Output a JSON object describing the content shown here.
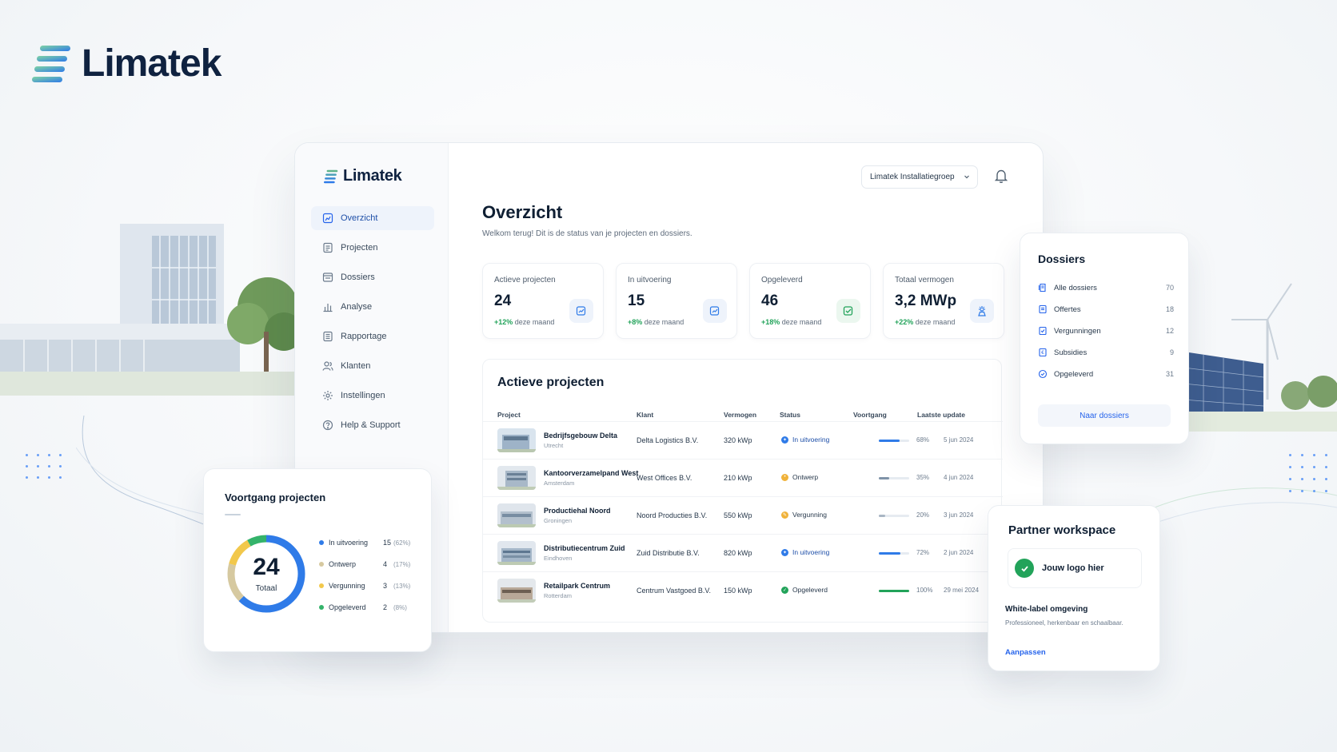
{
  "brand": {
    "name": "Limatek"
  },
  "sidebar": {
    "brand_name": "Limatek",
    "items": [
      {
        "label": "Overzicht",
        "icon": "dashboard-icon",
        "active": true
      },
      {
        "label": "Projecten",
        "icon": "document-icon"
      },
      {
        "label": "Dossiers",
        "icon": "folder-icon"
      },
      {
        "label": "Analyse",
        "icon": "bar-chart-icon"
      },
      {
        "label": "Rapportage",
        "icon": "report-icon"
      },
      {
        "label": "Klanten",
        "icon": "users-icon"
      },
      {
        "label": "Instellingen",
        "icon": "gear-icon"
      },
      {
        "label": "Help & Support",
        "icon": "help-icon"
      }
    ]
  },
  "header": {
    "org_select": "Limatek Installatiegroep"
  },
  "main": {
    "title": "Overzicht",
    "subtitle": "Welkom terug! Dit is de status van je projecten en dossiers.",
    "kpis": [
      {
        "label": "Actieve projecten",
        "value": "24",
        "delta": "+12%",
        "delta_suffix": "deze maand"
      },
      {
        "label": "In uitvoering",
        "value": "15",
        "delta": "+8%",
        "delta_suffix": "deze maand"
      },
      {
        "label": "Opgeleverd",
        "value": "46",
        "delta": "+18%",
        "delta_suffix": "deze maand"
      },
      {
        "label": "Totaal vermogen",
        "value": "3,2 MWp",
        "delta": "+22%",
        "delta_suffix": "deze maand"
      }
    ],
    "projects": {
      "title": "Actieve projecten",
      "columns": [
        "Project",
        "Klant",
        "Vermogen",
        "Status",
        "Voortgang",
        "Laatste update"
      ],
      "rows": [
        {
          "name": "Bedrijfsgebouw Delta",
          "city": "Utrecht",
          "client": "Delta Logistics B.V.",
          "power": "320 kWp",
          "status": "In uitvoering",
          "progress_text": "68%",
          "progress": 0.68,
          "updated": "5 jun 2024"
        },
        {
          "name": "Kantoorverzamelpand West",
          "city": "Amsterdam",
          "client": "West Offices B.V.",
          "power": "210 kWp",
          "status": "Ontwerp",
          "progress_text": "35%",
          "progress": 0.35,
          "updated": "4 jun 2024"
        },
        {
          "name": "Productiehal Noord",
          "city": "Groningen",
          "client": "Noord Producties B.V.",
          "power": "550 kWp",
          "status": "Vergunning",
          "progress_text": "20%",
          "progress": 0.2,
          "updated": "3 jun 2024"
        },
        {
          "name": "Distributiecentrum Zuid",
          "city": "Eindhoven",
          "client": "Zuid Distributie B.V.",
          "power": "820 kWp",
          "status": "In uitvoering",
          "progress_text": "72%",
          "progress": 0.72,
          "updated": "2 jun 2024"
        },
        {
          "name": "Retailpark Centrum",
          "city": "Rotterdam",
          "client": "Centrum Vastgoed B.V.",
          "power": "150 kWp",
          "status": "Opgeleverd",
          "progress_text": "100%",
          "progress": 1.0,
          "updated": "29 mei 2024"
        }
      ]
    }
  },
  "dossiers": {
    "title": "Dossiers",
    "items": [
      {
        "label": "Alle dossiers",
        "count": "70",
        "icon": "stack-icon"
      },
      {
        "label": "Offertes",
        "count": "18",
        "icon": "document-icon"
      },
      {
        "label": "Vergunningen",
        "count": "12",
        "icon": "permit-icon"
      },
      {
        "label": "Subsidies",
        "count": "9",
        "icon": "subsidy-icon"
      },
      {
        "label": "Opgeleverd",
        "count": "31",
        "icon": "check-circle-icon"
      }
    ],
    "button": "Naar dossiers"
  },
  "progress_card": {
    "title": "Voortgang projecten",
    "total": "24",
    "total_label": "Totaal",
    "segments": [
      {
        "label": "In uitvoering",
        "count": "15",
        "pct": "(62%)",
        "color": "#2f7be8"
      },
      {
        "label": "Ontwerp",
        "count": "4",
        "pct": "(17%)",
        "color": "#d6c9a0"
      },
      {
        "label": "Vergunning",
        "count": "3",
        "pct": "(13%)",
        "color": "#f2c84b"
      },
      {
        "label": "Opgeleverd",
        "count": "2",
        "pct": "(8%)",
        "color": "#34b36a"
      }
    ]
  },
  "partner": {
    "title": "Partner workspace",
    "logo_text": "Jouw logo hier",
    "wl_title": "White-label omgeving",
    "wl_sub": "Professioneel, herkenbaar en schaalbaar.",
    "link": "Aanpassen"
  },
  "colors": {
    "accent": "#2563eb",
    "success": "#22a35a",
    "navy": "#0f2240",
    "status_design": "#f0b23a",
    "status_permit": "#f0b23a"
  }
}
